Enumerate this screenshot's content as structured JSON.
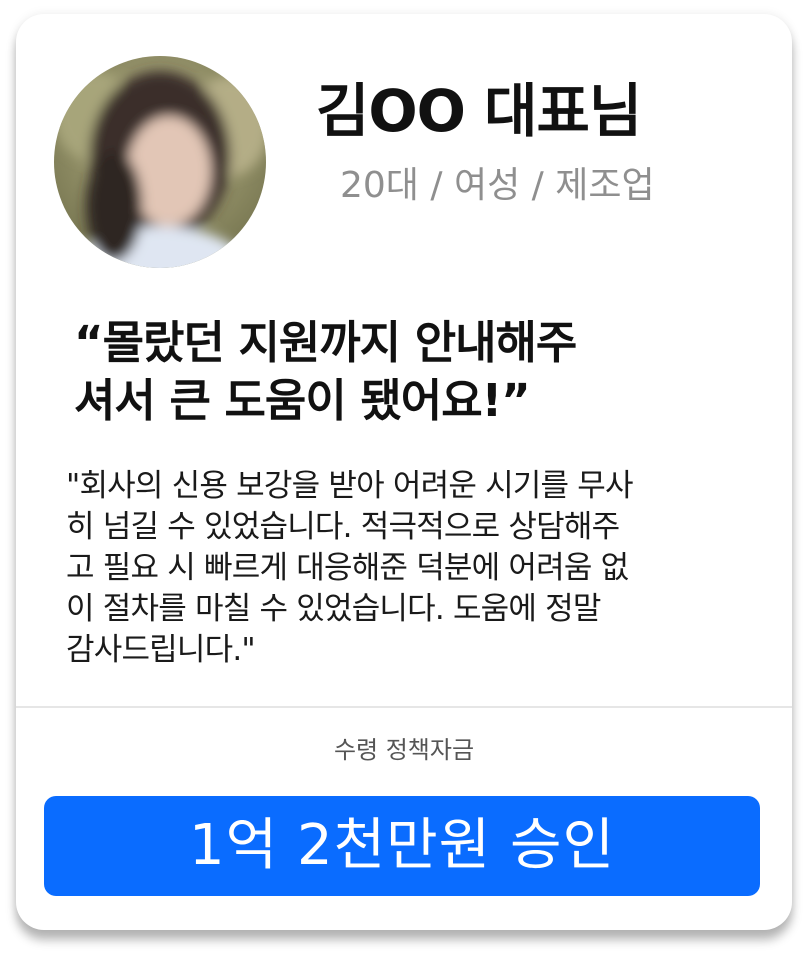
{
  "profile": {
    "name": "김OO 대표님",
    "meta": "20대 / 여성 / 제조업"
  },
  "testimonial": {
    "headline_lines": [
      "“몰랐던 지원까지 안내해주",
      "셔서 큰 도움이 됐어요!”"
    ],
    "body_lines": [
      "\"회사의 신용 보강을 받아 어려운 시기를 무사",
      "히 넘길 수 있었습니다. 적극적으로 상담해주",
      "고 필요 시 빠르게 대응해준 덕분에 어려움 없",
      "이 절차를 마칠 수 있었습니다. 도움에 정말",
      "감사드립니다.\""
    ]
  },
  "fund": {
    "label": "수령 정책자금",
    "amount_button": "1억 2천만원 승인"
  },
  "colors": {
    "accent": "#0a6cff",
    "meta_text": "#8f8f8f",
    "headline_text": "#111111"
  }
}
